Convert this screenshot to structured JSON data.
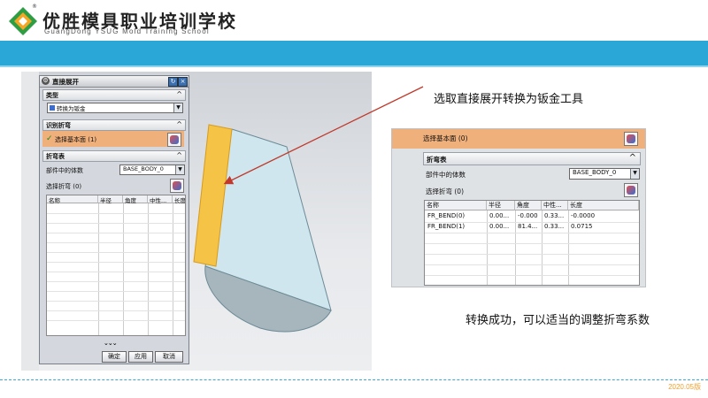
{
  "header": {
    "school_name_cn": "优胜模具职业培训学校",
    "school_name_en": "GuangDong YSUG Mold Training School",
    "registered_mark": "®"
  },
  "dialog": {
    "title": "直接展开",
    "sections": {
      "type": {
        "label": "类型",
        "value": "转换为钣金"
      },
      "identify_bend": {
        "label": "识别折弯",
        "select_face": "选择基本面 (1)"
      },
      "bend_table": {
        "label": "折弯表",
        "body_label": "部件中的体数",
        "body_value": "BASE_BODY_0",
        "select_bend": "选择折弯 (0)",
        "columns": [
          "名称",
          "半径",
          "角度",
          "中性...",
          "长度"
        ]
      }
    },
    "buttons": {
      "ok": "确定",
      "apply": "应用",
      "cancel": "取消"
    }
  },
  "callouts": {
    "top": "选取直接展开转换为钣金工具",
    "bottom": "转换成功，可以适当的调整折弯系数"
  },
  "zoom": {
    "select_face": "选择基本面 (0)",
    "bend_table_label": "折弯表",
    "body_label": "部件中的体数",
    "body_value": "BASE_BODY_0",
    "select_bend": "选择折弯 (0)",
    "columns": [
      "名称",
      "半径",
      "角度",
      "中性...",
      "长度"
    ],
    "rows": [
      [
        "FR_BEND(0)",
        "0.00...",
        "-0.000",
        "0.33...",
        "-0.0000"
      ],
      [
        "FR_BEND(1)",
        "0.00...",
        "81.4...",
        "0.33...",
        "0.0715"
      ]
    ]
  },
  "footer": {
    "version": "2020.05版"
  },
  "colors": {
    "accent_bar": "#2aa7d6",
    "selection_orange": "#f0b07c",
    "part_yellow": "#f5c346",
    "part_blue": "#cfe6ee"
  }
}
